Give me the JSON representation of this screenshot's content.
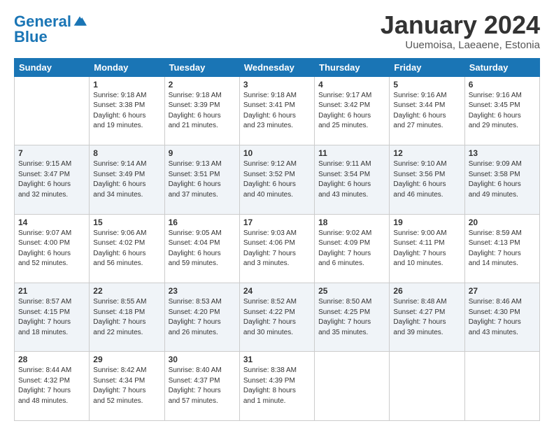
{
  "header": {
    "logo_line1": "General",
    "logo_line2": "Blue",
    "title": "January 2024",
    "subtitle": "Uuemoisa, Laeaene, Estonia"
  },
  "columns": [
    "Sunday",
    "Monday",
    "Tuesday",
    "Wednesday",
    "Thursday",
    "Friday",
    "Saturday"
  ],
  "weeks": [
    [
      {
        "day": "",
        "text": ""
      },
      {
        "day": "1",
        "text": "Sunrise: 9:18 AM\nSunset: 3:38 PM\nDaylight: 6 hours\nand 19 minutes."
      },
      {
        "day": "2",
        "text": "Sunrise: 9:18 AM\nSunset: 3:39 PM\nDaylight: 6 hours\nand 21 minutes."
      },
      {
        "day": "3",
        "text": "Sunrise: 9:18 AM\nSunset: 3:41 PM\nDaylight: 6 hours\nand 23 minutes."
      },
      {
        "day": "4",
        "text": "Sunrise: 9:17 AM\nSunset: 3:42 PM\nDaylight: 6 hours\nand 25 minutes."
      },
      {
        "day": "5",
        "text": "Sunrise: 9:16 AM\nSunset: 3:44 PM\nDaylight: 6 hours\nand 27 minutes."
      },
      {
        "day": "6",
        "text": "Sunrise: 9:16 AM\nSunset: 3:45 PM\nDaylight: 6 hours\nand 29 minutes."
      }
    ],
    [
      {
        "day": "7",
        "text": "Sunrise: 9:15 AM\nSunset: 3:47 PM\nDaylight: 6 hours\nand 32 minutes."
      },
      {
        "day": "8",
        "text": "Sunrise: 9:14 AM\nSunset: 3:49 PM\nDaylight: 6 hours\nand 34 minutes."
      },
      {
        "day": "9",
        "text": "Sunrise: 9:13 AM\nSunset: 3:51 PM\nDaylight: 6 hours\nand 37 minutes."
      },
      {
        "day": "10",
        "text": "Sunrise: 9:12 AM\nSunset: 3:52 PM\nDaylight: 6 hours\nand 40 minutes."
      },
      {
        "day": "11",
        "text": "Sunrise: 9:11 AM\nSunset: 3:54 PM\nDaylight: 6 hours\nand 43 minutes."
      },
      {
        "day": "12",
        "text": "Sunrise: 9:10 AM\nSunset: 3:56 PM\nDaylight: 6 hours\nand 46 minutes."
      },
      {
        "day": "13",
        "text": "Sunrise: 9:09 AM\nSunset: 3:58 PM\nDaylight: 6 hours\nand 49 minutes."
      }
    ],
    [
      {
        "day": "14",
        "text": "Sunrise: 9:07 AM\nSunset: 4:00 PM\nDaylight: 6 hours\nand 52 minutes."
      },
      {
        "day": "15",
        "text": "Sunrise: 9:06 AM\nSunset: 4:02 PM\nDaylight: 6 hours\nand 56 minutes."
      },
      {
        "day": "16",
        "text": "Sunrise: 9:05 AM\nSunset: 4:04 PM\nDaylight: 6 hours\nand 59 minutes."
      },
      {
        "day": "17",
        "text": "Sunrise: 9:03 AM\nSunset: 4:06 PM\nDaylight: 7 hours\nand 3 minutes."
      },
      {
        "day": "18",
        "text": "Sunrise: 9:02 AM\nSunset: 4:09 PM\nDaylight: 7 hours\nand 6 minutes."
      },
      {
        "day": "19",
        "text": "Sunrise: 9:00 AM\nSunset: 4:11 PM\nDaylight: 7 hours\nand 10 minutes."
      },
      {
        "day": "20",
        "text": "Sunrise: 8:59 AM\nSunset: 4:13 PM\nDaylight: 7 hours\nand 14 minutes."
      }
    ],
    [
      {
        "day": "21",
        "text": "Sunrise: 8:57 AM\nSunset: 4:15 PM\nDaylight: 7 hours\nand 18 minutes."
      },
      {
        "day": "22",
        "text": "Sunrise: 8:55 AM\nSunset: 4:18 PM\nDaylight: 7 hours\nand 22 minutes."
      },
      {
        "day": "23",
        "text": "Sunrise: 8:53 AM\nSunset: 4:20 PM\nDaylight: 7 hours\nand 26 minutes."
      },
      {
        "day": "24",
        "text": "Sunrise: 8:52 AM\nSunset: 4:22 PM\nDaylight: 7 hours\nand 30 minutes."
      },
      {
        "day": "25",
        "text": "Sunrise: 8:50 AM\nSunset: 4:25 PM\nDaylight: 7 hours\nand 35 minutes."
      },
      {
        "day": "26",
        "text": "Sunrise: 8:48 AM\nSunset: 4:27 PM\nDaylight: 7 hours\nand 39 minutes."
      },
      {
        "day": "27",
        "text": "Sunrise: 8:46 AM\nSunset: 4:30 PM\nDaylight: 7 hours\nand 43 minutes."
      }
    ],
    [
      {
        "day": "28",
        "text": "Sunrise: 8:44 AM\nSunset: 4:32 PM\nDaylight: 7 hours\nand 48 minutes."
      },
      {
        "day": "29",
        "text": "Sunrise: 8:42 AM\nSunset: 4:34 PM\nDaylight: 7 hours\nand 52 minutes."
      },
      {
        "day": "30",
        "text": "Sunrise: 8:40 AM\nSunset: 4:37 PM\nDaylight: 7 hours\nand 57 minutes."
      },
      {
        "day": "31",
        "text": "Sunrise: 8:38 AM\nSunset: 4:39 PM\nDaylight: 8 hours\nand 1 minute."
      },
      {
        "day": "",
        "text": ""
      },
      {
        "day": "",
        "text": ""
      },
      {
        "day": "",
        "text": ""
      }
    ]
  ]
}
